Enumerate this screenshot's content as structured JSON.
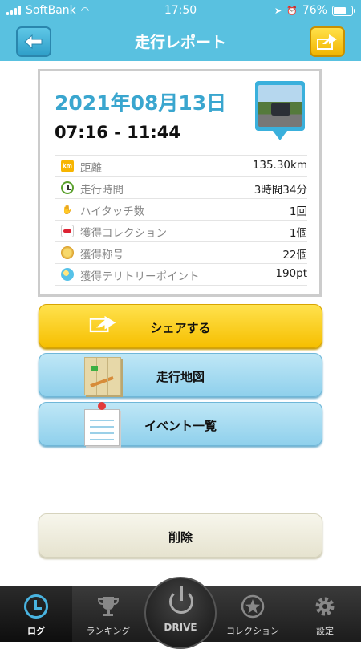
{
  "status_bar": {
    "carrier": "SoftBank",
    "time": "17:50",
    "battery_percent": "76%",
    "battery_level": 0.76
  },
  "header": {
    "title": "走行レポート",
    "back_icon": "back-arrow-icon",
    "share_icon": "share-arrow-icon"
  },
  "report": {
    "date": "2021年08月13日",
    "time_range": "07:16 - 11:44",
    "stats": [
      {
        "icon": "km-icon",
        "label": "距離",
        "value": "135.30km"
      },
      {
        "icon": "clock-icon",
        "label": "走行時間",
        "value": "3時間34分"
      },
      {
        "icon": "high-five-icon",
        "label": "ハイタッチ数",
        "value": "1回"
      },
      {
        "icon": "car-collection-icon",
        "label": "獲得コレクション",
        "value": "1個"
      },
      {
        "icon": "medal-icon",
        "label": "獲得称号",
        "value": "22個"
      },
      {
        "icon": "territory-icon",
        "label": "獲得テリトリーポイント",
        "value": "190pt"
      }
    ]
  },
  "actions": {
    "share": "シェアする",
    "map": "走行地図",
    "events": "イベント一覧",
    "delete": "削除"
  },
  "tabbar": {
    "log": "ログ",
    "ranking": "ランキング",
    "drive": "DRIVE",
    "collection": "コレクション",
    "settings": "設定"
  },
  "colors": {
    "header_blue": "#59c1e0",
    "accent_blue": "#3aa6cf",
    "share_yellow": "#f6bf00"
  }
}
